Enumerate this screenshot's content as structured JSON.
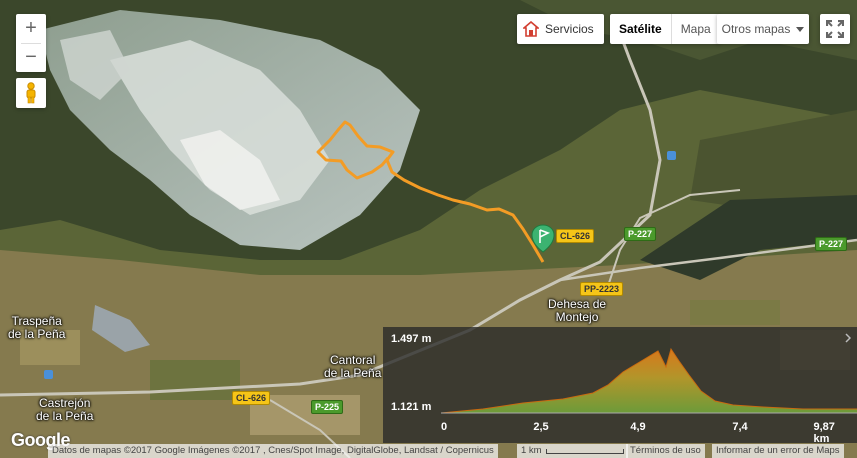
{
  "controls": {
    "zoom_in": "+",
    "zoom_out": "−",
    "servicios": "Servicios",
    "satellite": "Satélite",
    "map": "Mapa",
    "other_maps": "Otros mapas",
    "map_type_active": "Satélite"
  },
  "places": {
    "traspena": "Traspeña de la Peña",
    "traspena_l1": "Traspeña",
    "traspena_l2": "de la Peña",
    "cantoral_l1": "Cantoral",
    "cantoral_l2": "de la Peña",
    "castrejon_l1": "Castrejón",
    "castrejon_l2": "de la Peña",
    "dehesa_l1": "Dehesa de",
    "dehesa_l2": "Montejo"
  },
  "roads": {
    "cl626_a": "CL-626",
    "cl626_b": "CL-626",
    "p227_a": "P-227",
    "p227_b": "P-227",
    "pp2223": "PP-2223",
    "p225": "P-225",
    "pp2223_b": "PP-2223"
  },
  "elevation": {
    "max": "1.497 m",
    "min": "1.121 m",
    "ticks": [
      "0",
      "2,5",
      "4,9",
      "7,4",
      "9,87 km"
    ],
    "profile_colors": {
      "low": "#6fa03a",
      "high": "#d88a1d"
    }
  },
  "track": {
    "color": "#f39c25"
  },
  "footer": {
    "logo": "Google",
    "attribution": "Datos de mapas ©2017 Google Imágenes ©2017 , Cnes/Spot Image, DigitalGlobe, Landsat / Copernicus",
    "scale": "1 km",
    "terms": "Términos de uso",
    "report": "Informar de un error de Maps"
  }
}
